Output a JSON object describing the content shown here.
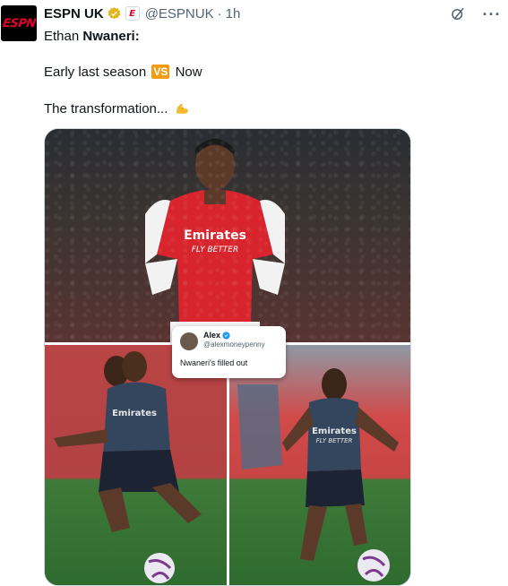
{
  "tweet": {
    "avatar_logo": "ESPN",
    "display_name": "ESPN UK",
    "affiliate_badge": "E",
    "handle": "@ESPNUK",
    "separator": "·",
    "time": "1h",
    "line1_prefix": "Ethan ",
    "line1_bold": "Nwaneri:",
    "line2_before": "Early last season ",
    "line2_badge": "VS",
    "line2_after": " Now",
    "line3": "The transformation...",
    "line3_emoji": "flexed-biceps-icon",
    "icons": {
      "grok": "grok-icon",
      "more": "more-icon"
    },
    "colors": {
      "brand": "#e4002b",
      "gold_check": "#e2b719",
      "vs_badge": "#f39c12"
    }
  },
  "media": {
    "panels": [
      "top-player-photo",
      "bottom-left-training-photo",
      "bottom-right-training-photo"
    ],
    "quote_card": {
      "name": "Alex",
      "handle": "@alexmoneypenny",
      "text": "Nwaneri's filled out"
    }
  }
}
